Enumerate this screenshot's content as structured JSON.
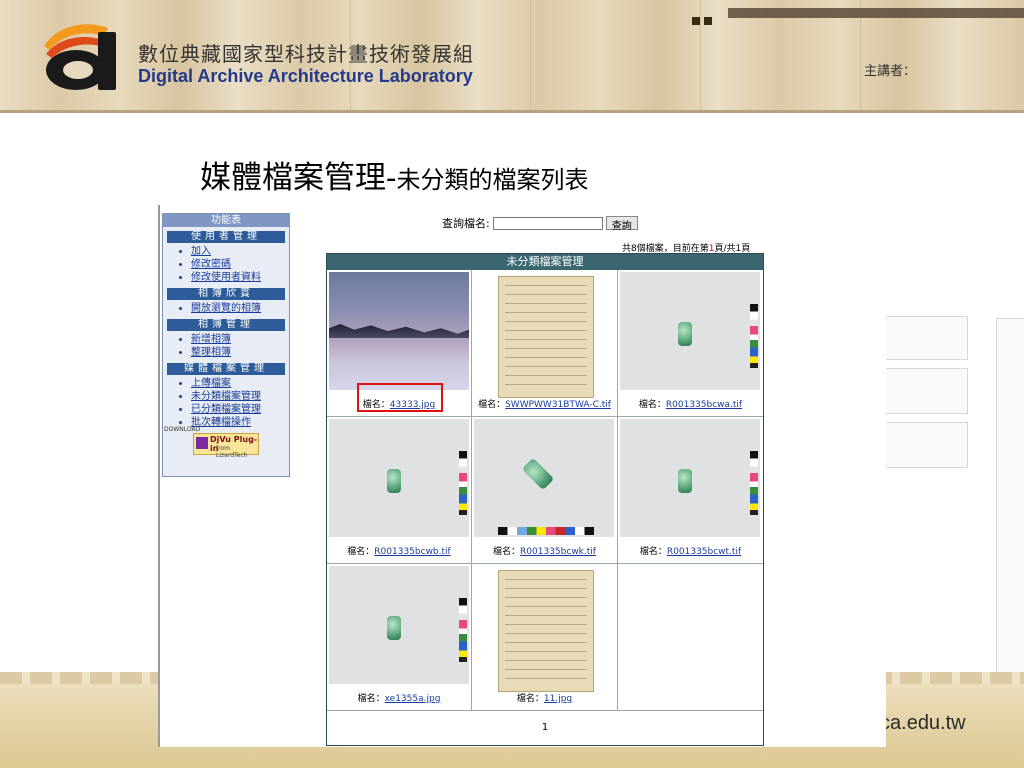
{
  "banner": {
    "org_cn": "數位典藏國家型科技計畫技術發展組",
    "org_en": "Digital Archive Architecture Laboratory",
    "speaker": "主講者："
  },
  "slide": {
    "title_main": "媒體檔案管理-",
    "title_sub": "未分類的檔案列表"
  },
  "footer": {
    "url": "inica.edu.tw"
  },
  "app": {
    "sidebar": {
      "top_label": "功能表",
      "sections": [
        {
          "title": "使用者管理",
          "items": [
            "加入",
            "修改密碼",
            "修改使用者資料"
          ]
        },
        {
          "title": "相簿欣賞",
          "items": [
            "開放瀏覽的相簿"
          ]
        },
        {
          "title": "相簿管理",
          "items": [
            "新增相簿",
            "整理相簿"
          ]
        },
        {
          "title": "媒體檔案管理",
          "items": [
            "上傳檔案",
            "未分類檔案管理",
            "已分類檔案管理",
            "批次轉檔操作"
          ]
        }
      ],
      "plugin": {
        "download": "DOWNLOAD",
        "title": "DjVu Plug-in",
        "sub": "from LizardTech"
      }
    },
    "search": {
      "label": "查詢檔名:",
      "value": "",
      "button": "查詢"
    },
    "count": {
      "prefix": "共8個檔案，目前在第",
      "page": "1",
      "suffix": "頁/共1頁"
    },
    "grid": {
      "header": "未分類檔案管理",
      "name_label": "檔名：",
      "files": [
        {
          "name": "43333.jpg",
          "kind": "landscape",
          "highlight": true
        },
        {
          "name": "SWWPWW31BTWA-C.tif",
          "kind": "document"
        },
        {
          "name": "R001335bcwa.tif",
          "kind": "jade"
        },
        {
          "name": "R001335bcwb.tif",
          "kind": "jade"
        },
        {
          "name": "R001335bcwk.tif",
          "kind": "jade-angled"
        },
        {
          "name": "R001335bcwt.tif",
          "kind": "jade"
        },
        {
          "name": "xe1355a.jpg",
          "kind": "jade"
        },
        {
          "name": "11.jpg",
          "kind": "document"
        }
      ],
      "pager": "1"
    }
  }
}
